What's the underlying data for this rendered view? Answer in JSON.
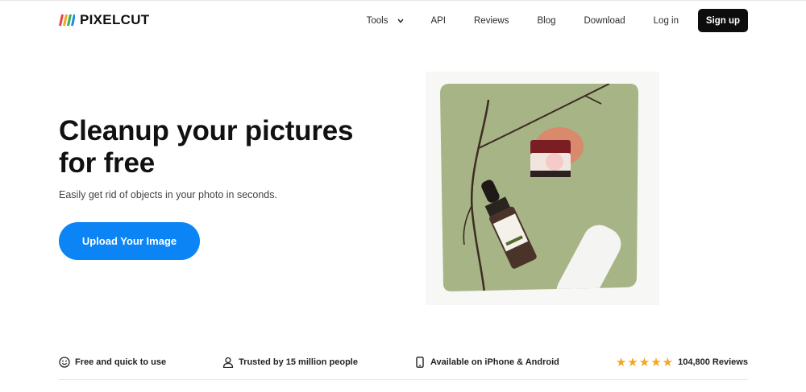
{
  "brand": {
    "name": "PIXELCUT",
    "logo_colors": [
      "#e8453c",
      "#f5a623",
      "#34b34a",
      "#1e88e5"
    ]
  },
  "nav": {
    "tools": "Tools",
    "api": "API",
    "reviews": "Reviews",
    "blog": "Blog",
    "download": "Download",
    "login": "Log in",
    "signup": "Sign up"
  },
  "hero": {
    "title_line1": "Cleanup your pictures",
    "title_line2": "for free",
    "subtitle": "Easily get rid of objects in your photo in seconds.",
    "cta": "Upload Your Image"
  },
  "features": {
    "free": {
      "label": "Free and quick to use",
      "icon": "smiley-icon"
    },
    "trusted": {
      "label": "Trusted by 15 million people",
      "icon": "person-icon"
    },
    "available": {
      "label": "Available on iPhone & Android",
      "icon": "phone-icon"
    },
    "reviews": {
      "label": "104,800 Reviews",
      "stars": 5,
      "icon": "star-icon"
    }
  },
  "colors": {
    "accent": "#0b84f5",
    "signup_bg": "#0d0d0d",
    "star": "#f4a621",
    "photo_bg": "#a7b486"
  }
}
